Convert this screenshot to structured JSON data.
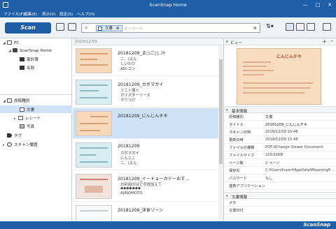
{
  "window": {
    "title": "ScanSnap Home",
    "controls": [
      "—",
      "□",
      "✕"
    ]
  },
  "menu": [
    "ファイル(F)",
    "編集(E)",
    "表示(V)",
    "設定(S)",
    "ヘルプ(H)"
  ],
  "toolbar": {
    "scan_label": "Scan",
    "search_tag": "文書",
    "search_placeholder": "キーワード"
  },
  "sidebar": {
    "pc_label": "PC",
    "home_label": "ScanSnap Home",
    "folders": [
      "家計簿",
      "名刺"
    ],
    "doc_types_label": "原稿種別",
    "doc_types": [
      "文書",
      "レシート",
      "写真"
    ],
    "tag_label": "タグ",
    "history_label": "スキャン履歴"
  },
  "list": {
    "date_header": "2018/12/09",
    "items": [
      {
        "title": "20181209_ま○ご□..汁",
        "l2": "ニ、(よん",
        "l3": "しいたけ",
        "l4": "ASI-コン",
        "style": "orange"
      },
      {
        "title": "20181209_カボマガイ",
        "l2": "ミニト揚卜",
        "l3": "ガイズターソース",
        "l4": "すりつけ",
        "style": "blue"
      },
      {
        "title": "20181209_にんじんチキ",
        "l2": "",
        "l3": "",
        "l4": "",
        "style": "orange"
      },
      {
        "title": "20181209",
        "l2": "カボマガイ",
        "l3": "にんじこ",
        "l4": "ニ、(よん",
        "style": "blue"
      },
      {
        "title": "20181209_イートョーカドーおす…",
        "l2": "お利用のほど手提加えて",
        "l3": "◆◆◆◆◆◆◆",
        "l4": "AJINOMOTO",
        "style": "photo"
      },
      {
        "title": "20181209_洋食ゾーン",
        "l2": "",
        "l3": "",
        "l4": "",
        "style": "white"
      }
    ]
  },
  "viewer": {
    "header": "ビュー",
    "preview_title": "にんじんチキ"
  },
  "props": {
    "basic_header": "基本情報",
    "rows": [
      {
        "k": "原稿種別",
        "v": "文書"
      },
      {
        "k": "タイトル",
        "v": "20181209_にんじんチキ"
      },
      {
        "k": "スキャン日時",
        "v": "2018/12/09 15:48"
      },
      {
        "k": "更新日時",
        "v": "2018/12/09 15:48"
      },
      {
        "k": "ファイルの種類",
        "v": "PDF-XChange Viewer Document"
      },
      {
        "k": "ファイルサイズ",
        "v": "229.61KB"
      },
      {
        "k": "ページ数",
        "v": "2 ページ"
      },
      {
        "k": "保存先",
        "v": "C:¥Users¥user¥AppData¥Roaming¥..."
      },
      {
        "k": "パスワード",
        "v": "なし"
      },
      {
        "k": "連携アプリケーション",
        "v": ""
      }
    ],
    "doc_header": "文書情報",
    "doc_rows": [
      {
        "k": "メモ",
        "v": ""
      },
      {
        "k": "文書日付",
        "v": ""
      }
    ]
  },
  "status": {
    "brand": "ScanSnap"
  },
  "colors": {
    "accent": "#1f5fa8",
    "selection": "#cde2f6",
    "thumb_orange": "#f7d9b9",
    "thumb_blue": "#d7eef2"
  }
}
